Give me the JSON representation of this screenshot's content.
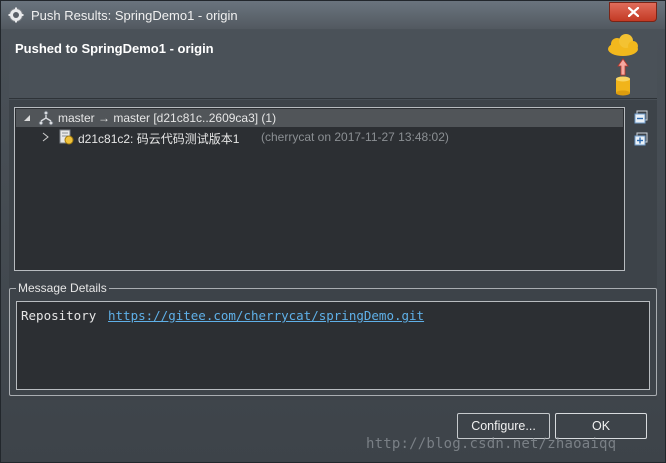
{
  "window": {
    "title": "Push Results: SpringDemo1 - origin"
  },
  "header": {
    "title": "Pushed to SpringDemo1 - origin"
  },
  "tree": {
    "ref_row": {
      "label": "master → master [d21c81c..2609ca3] (1)"
    },
    "commit_row": {
      "label": "d21c81c2: 码云代码测试版本1",
      "meta": "(cherrycat on 2017-11-27 13:48:02)"
    }
  },
  "message_details": {
    "legend": "Message Details",
    "repository_label": "Repository",
    "repository_url": "https://gitee.com/cherrycat/springDemo.git"
  },
  "buttons": {
    "configure": "Configure...",
    "ok": "OK"
  },
  "watermark": "http://blog.csdn.net/zhaoaiqq",
  "colors": {
    "link": "#5fb0e8",
    "tree_background": "#2c2f33",
    "window_background": "#3d4349"
  },
  "icons": {
    "app": "eclipse-gear-icon",
    "close": "close-icon",
    "push": "cloud-push-database-icon",
    "branch": "branch-icon",
    "commit": "commit-icon",
    "collapse_all": "collapse-all-icon",
    "expand_all": "expand-all-icon"
  }
}
